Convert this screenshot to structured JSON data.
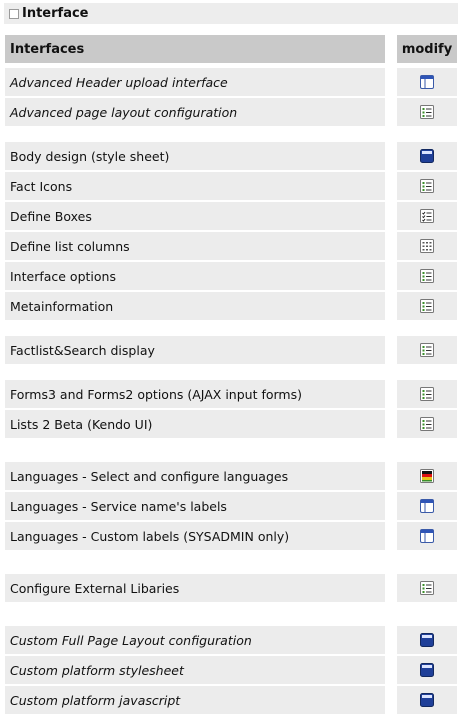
{
  "section": {
    "title": "Interface"
  },
  "table": {
    "col_name": "Interfaces",
    "col_action": "modify"
  },
  "rows": [
    {
      "label": "Advanced Header upload interface",
      "icon": "window-header-icon",
      "italic": true
    },
    {
      "label": "Advanced page layout configuration",
      "icon": "list-config-icon",
      "italic": true
    },
    {
      "label": "Body design (style sheet)",
      "icon": "stylesheet-icon",
      "italic": false
    },
    {
      "label": "Fact Icons",
      "icon": "list-config-icon",
      "italic": false
    },
    {
      "label": "Define Boxes",
      "icon": "checklist-icon",
      "italic": false
    },
    {
      "label": "Define list columns",
      "icon": "table-columns-icon",
      "italic": false
    },
    {
      "label": "Interface options",
      "icon": "list-config-icon",
      "italic": false
    },
    {
      "label": "Metainformation",
      "icon": "list-config-icon",
      "italic": false
    },
    {
      "label": "Factlist&Search display",
      "icon": "list-config-icon",
      "italic": false
    },
    {
      "label": "Forms3 and Forms2 options (AJAX input forms)",
      "icon": "list-config-icon",
      "italic": false
    },
    {
      "label": "Lists 2 Beta (Kendo UI)",
      "icon": "list-config-icon",
      "italic": false
    },
    {
      "label": "Languages - Select and configure languages",
      "icon": "flag-icon",
      "italic": false
    },
    {
      "label": "Languages - Service name's labels",
      "icon": "window-header-icon",
      "italic": false
    },
    {
      "label": "Languages - Custom labels (SYSADMIN only)",
      "icon": "window-header-icon",
      "italic": false
    },
    {
      "label": "Configure External Libaries",
      "icon": "list-config-icon",
      "italic": false
    },
    {
      "label": "Custom Full Page Layout configuration",
      "icon": "stylesheet-icon",
      "italic": true
    },
    {
      "label": "Custom platform stylesheet",
      "icon": "stylesheet-icon",
      "italic": true
    },
    {
      "label": "Custom platform javascript",
      "icon": "stylesheet-icon",
      "italic": true
    }
  ]
}
